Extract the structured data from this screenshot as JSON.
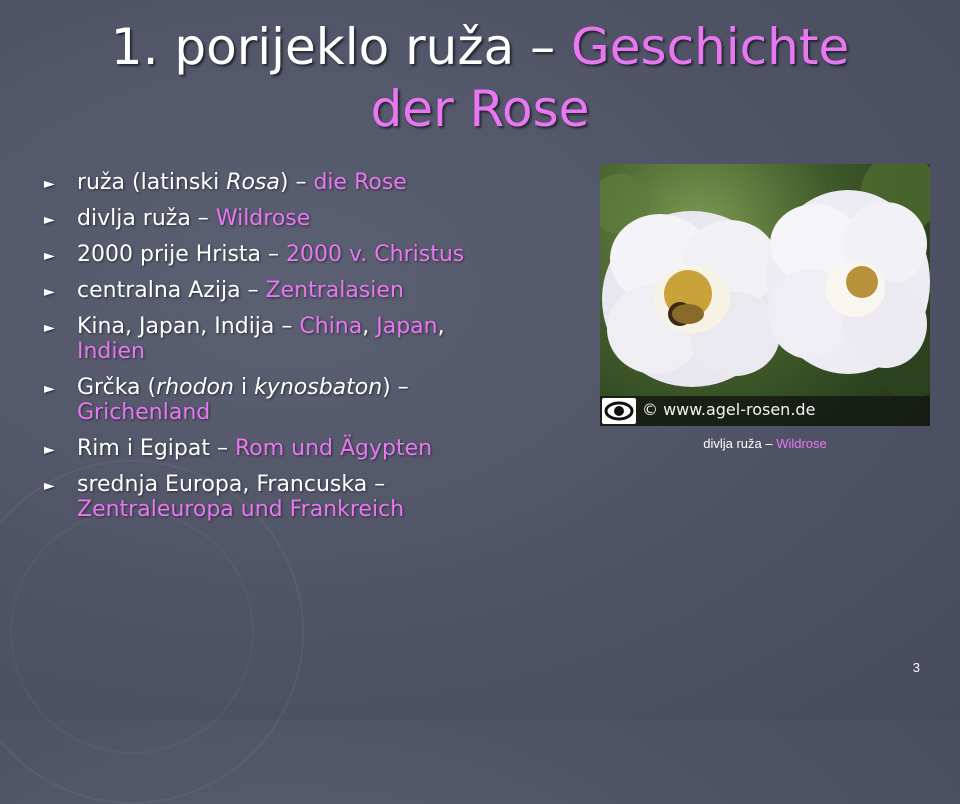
{
  "title": {
    "prefix": "1.  porijeklo ruža – ",
    "highlight_line1": "Geschichte",
    "highlight_line2": "der Rose"
  },
  "bullets": [
    {
      "parts": [
        {
          "t": "ruža (latinski ",
          "c": "w"
        },
        {
          "t": "Rosa",
          "c": "wi"
        },
        {
          "t": ") – ",
          "c": "w"
        },
        {
          "t": "die Rose",
          "c": "p"
        }
      ]
    },
    {
      "parts": [
        {
          "t": "divlja ruža – ",
          "c": "w"
        },
        {
          "t": "Wildrose",
          "c": "p"
        }
      ]
    },
    {
      "parts": [
        {
          "t": "2000 prije Hrista – ",
          "c": "w"
        },
        {
          "t": "2000 v. Christus",
          "c": "p"
        }
      ]
    },
    {
      "parts": [
        {
          "t": "centralna Azija – ",
          "c": "w"
        },
        {
          "t": "Zentralasien",
          "c": "p"
        }
      ]
    },
    {
      "parts": [
        {
          "t": "Kina, Japan, Indija – ",
          "c": "w"
        },
        {
          "t": "China",
          "c": "p"
        },
        {
          "t": ", ",
          "c": "w"
        },
        {
          "t": "Japan",
          "c": "p"
        },
        {
          "t": ", ",
          "c": "w"
        },
        {
          "t": "Indien",
          "c": "p"
        }
      ]
    },
    {
      "parts": [
        {
          "t": "Grčka (",
          "c": "w"
        },
        {
          "t": "rhodon",
          "c": "wi"
        },
        {
          "t": " i ",
          "c": "w"
        },
        {
          "t": "kynosbaton",
          "c": "wi"
        },
        {
          "t": ") – ",
          "c": "w"
        },
        {
          "t": "Grichenland",
          "c": "p"
        }
      ]
    },
    {
      "parts": [
        {
          "t": "Rim i Egipat – ",
          "c": "w"
        },
        {
          "t": "Rom und Ägypten",
          "c": "p"
        }
      ]
    },
    {
      "parts": [
        {
          "t": "srednja Europa, Francuska – ",
          "c": "w"
        },
        {
          "t": "Zentraleuropa und Frankreich",
          "c": "p"
        }
      ]
    }
  ],
  "photo": {
    "watermark": "© www.agel-rosen.de",
    "icon": "eye-icon"
  },
  "caption": {
    "plain": "divlja ruža – ",
    "highlight": "Wildrose"
  },
  "slide_number": "3",
  "colors": {
    "background": "#4f5365",
    "highlight": "#e877f1",
    "text": "#ffffff"
  }
}
